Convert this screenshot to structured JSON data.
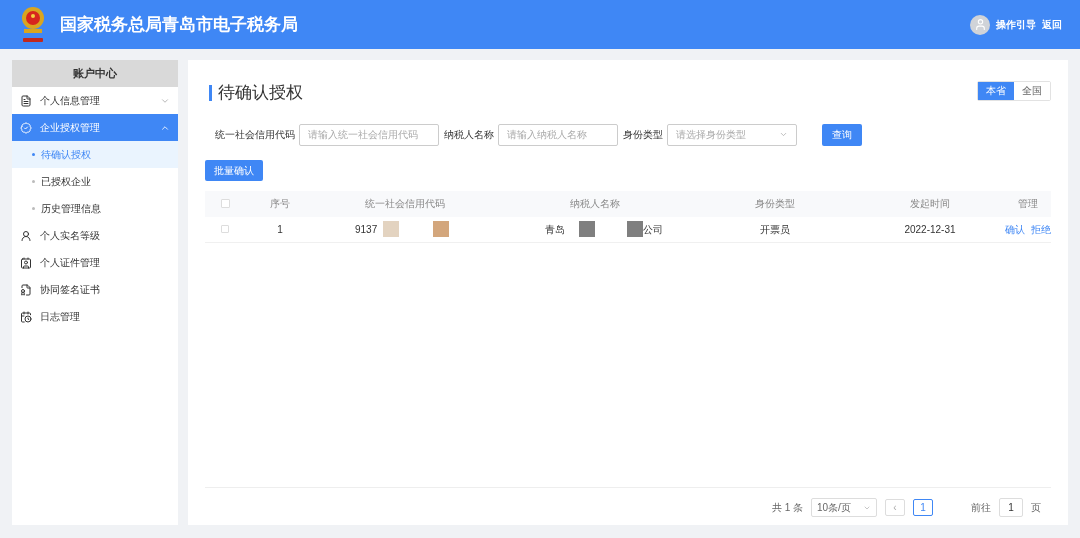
{
  "header": {
    "title": "国家税务总局青岛市电子税务局",
    "links": [
      "操作引导",
      "返回"
    ]
  },
  "sidebar": {
    "title": "账户中心",
    "items": [
      {
        "label": "个人信息管理",
        "expanded": false,
        "selected": false
      },
      {
        "label": "企业授权管理",
        "expanded": true,
        "selected": true,
        "children": [
          {
            "label": "待确认授权",
            "selected": true
          },
          {
            "label": "已授权企业",
            "selected": false
          },
          {
            "label": "历史管理信息",
            "selected": false
          }
        ]
      },
      {
        "label": "个人实名等级",
        "selected": false
      },
      {
        "label": "个人证件管理",
        "selected": false
      },
      {
        "label": "协同签名证书",
        "selected": false
      },
      {
        "label": "日志管理",
        "selected": false
      }
    ]
  },
  "page": {
    "title": "待确认授权",
    "scope_tabs": [
      {
        "label": "本省",
        "selected": true
      },
      {
        "label": "全国",
        "selected": false
      }
    ]
  },
  "filters": [
    {
      "label": "统一社会信用代码",
      "placeholder": "请输入统一社会信用代码",
      "kind": "input"
    },
    {
      "label": "纳税人名称",
      "placeholder": "请输入纳税人名称",
      "kind": "input"
    },
    {
      "label": "身份类型",
      "placeholder": "请选择身份类型",
      "kind": "select"
    }
  ],
  "search_button": "查询",
  "batch_button": "批量确认",
  "table": {
    "header_checked": false,
    "columns": [
      "序号",
      "统一社会信用代码",
      "纳税人名称",
      "身份类型",
      "发起时间",
      "管理"
    ],
    "rows": [
      {
        "checked": false,
        "index": "1",
        "code": "9137",
        "name_start": "青岛",
        "name_end": "公司",
        "role": "开票员",
        "time": "2022-12-31",
        "actions": [
          "确认",
          "拒绝"
        ]
      }
    ]
  },
  "pagination": {
    "total": "共 1 条",
    "page_size": "10条/页",
    "prev": "‹",
    "pages": [
      {
        "label": "1",
        "selected": true
      }
    ],
    "goto_label": "前往",
    "goto_value": "1",
    "goto_suffix": "页"
  }
}
